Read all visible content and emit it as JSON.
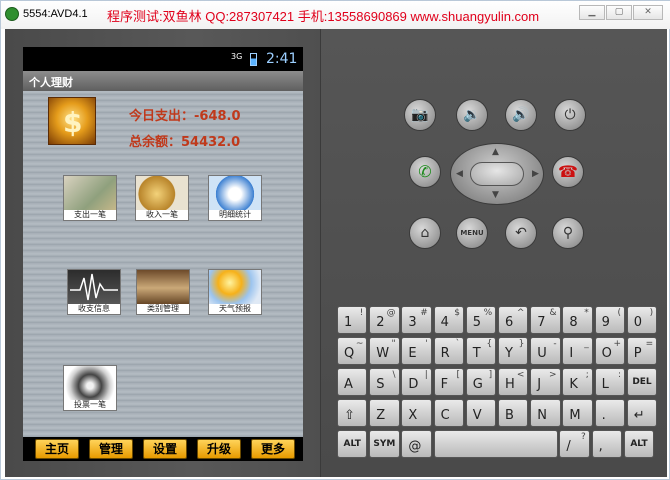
{
  "window": {
    "title": "5554:AVD4.1",
    "banner": "程序测试:双鱼林 QQ:287307421 手机:13558690869 www.shuangyulin.com"
  },
  "status_bar": {
    "signal": "3G",
    "time": "2:41"
  },
  "app": {
    "title": "个人理财",
    "today_expense": "今日支出：-648.0",
    "total_balance": "总余额：54432.0",
    "tiles": [
      {
        "label": "支出一笔",
        "icon": "cash-icon"
      },
      {
        "label": "收入一笔",
        "icon": "coins-icon"
      },
      {
        "label": "明细统计",
        "icon": "pie-icon"
      },
      {
        "label": "收支信息",
        "icon": "waveform-icon"
      },
      {
        "label": "类别管理",
        "icon": "library-icon"
      },
      {
        "label": "天气预报",
        "icon": "weather-icon"
      },
      {
        "label": "投票一笔",
        "icon": "shell-icon"
      }
    ],
    "tabs": [
      "主页",
      "管理",
      "设置",
      "升级",
      "更多"
    ]
  },
  "keyboard": {
    "row1": [
      [
        "1",
        "!"
      ],
      [
        "2",
        "@"
      ],
      [
        "3",
        "#"
      ],
      [
        "4",
        "$"
      ],
      [
        "5",
        "%"
      ],
      [
        "6",
        "^"
      ],
      [
        "7",
        "&"
      ],
      [
        "8",
        "*"
      ],
      [
        "9",
        "("
      ],
      [
        "0",
        ")"
      ]
    ],
    "row2": [
      [
        "Q",
        "~"
      ],
      [
        "W",
        "\""
      ],
      [
        "E",
        "'"
      ],
      [
        "R",
        "`"
      ],
      [
        "T",
        "{"
      ],
      [
        "Y",
        "}"
      ],
      [
        "U",
        "-"
      ],
      [
        "I",
        "_"
      ],
      [
        "O",
        "+"
      ],
      [
        "P",
        "="
      ]
    ],
    "row3": [
      [
        "A",
        ""
      ],
      [
        "S",
        "\\"
      ],
      [
        "D",
        "|"
      ],
      [
        "F",
        "["
      ],
      [
        "G",
        "]"
      ],
      [
        "H",
        "<"
      ],
      [
        "J",
        ">"
      ],
      [
        "K",
        ";"
      ],
      [
        "L",
        ":"
      ],
      [
        "DEL",
        ""
      ]
    ],
    "row4": [
      [
        "⇧",
        ""
      ],
      [
        "Z",
        ""
      ],
      [
        "X",
        ""
      ],
      [
        "C",
        ""
      ],
      [
        "V",
        ""
      ],
      [
        "B",
        ""
      ],
      [
        "N",
        ""
      ],
      [
        "M",
        ""
      ],
      [
        ".",
        " "
      ],
      [
        "↵",
        ""
      ]
    ],
    "row5": [
      [
        "ALT",
        ""
      ],
      [
        "SYM",
        ""
      ],
      [
        "@",
        ""
      ],
      [
        "",
        ""
      ],
      [
        "/",
        "?"
      ],
      [
        ",",
        ""
      ],
      [
        "ALT",
        ""
      ]
    ]
  }
}
